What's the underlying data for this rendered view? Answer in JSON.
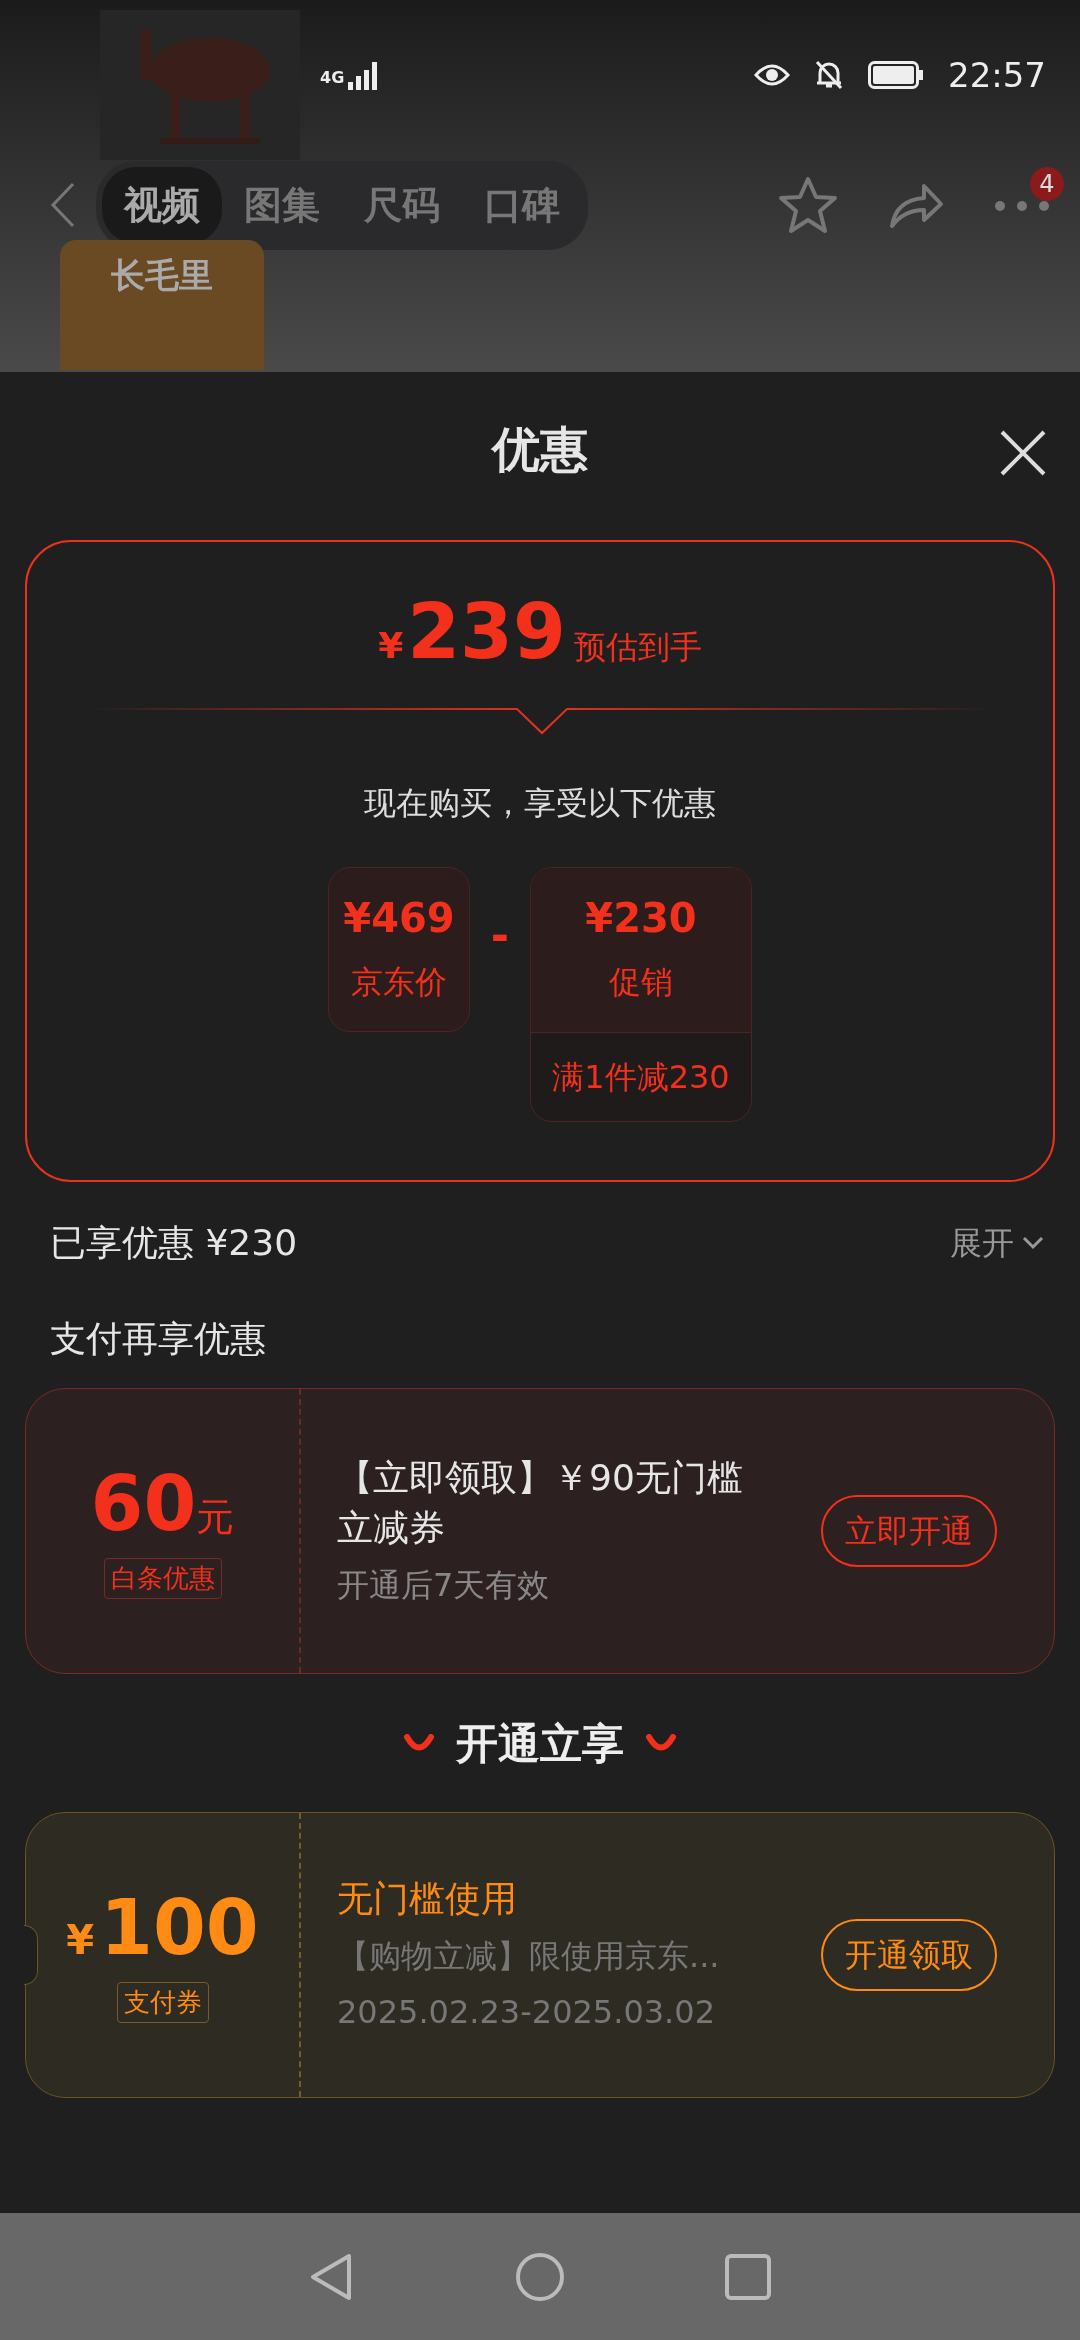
{
  "status_bar": {
    "network": "4G",
    "time": "22:57"
  },
  "top_nav": {
    "tabs": [
      {
        "label": "视频",
        "selected": true
      },
      {
        "label": "图集",
        "selected": false
      },
      {
        "label": "尺码",
        "selected": false
      },
      {
        "label": "口碑",
        "selected": false
      }
    ],
    "more_badge": "4"
  },
  "thumbnail": {
    "label": "长毛里"
  },
  "sheet": {
    "title": "优惠",
    "estimate": {
      "currency": "¥",
      "amount": "239",
      "label": "预估到手"
    },
    "intro": "现在购买，享受以下优惠",
    "breakdown": {
      "base": {
        "price": "¥469",
        "label": "京东价"
      },
      "operator": "-",
      "promo": {
        "price": "¥230",
        "label": "促销",
        "rule": "满1件减230"
      }
    },
    "enjoyed": {
      "text": "已享优惠 ¥230",
      "toggle": "展开"
    },
    "pay_section_title": "支付再享优惠",
    "coupons": [
      {
        "kind": "baitiao",
        "amount": "60",
        "unit": "元",
        "tag": "白条优惠",
        "title": "【立即领取】￥90无门槛立减券",
        "validity": "开通后7天有效",
        "button": "立即开通"
      },
      {
        "kind": "voucher",
        "currency": "¥",
        "amount": "100",
        "tag": "支付券",
        "title": "无门槛使用",
        "description": "【购物立减】限使用京东...",
        "validity": "2025.02.23-2025.03.02",
        "button": "开通领取"
      }
    ],
    "open_section_title": "开通立享"
  }
}
